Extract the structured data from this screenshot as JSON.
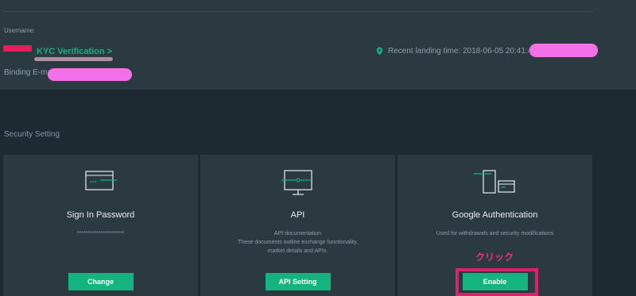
{
  "profile": {
    "username_label": "Username:",
    "kyc_link": "KYC Verification >",
    "binding_email_label": "Binding E-mai",
    "recent_landing_time": "Recent landing time: 2018-06-05 20:41:47"
  },
  "security": {
    "section_title": "Security Setting",
    "cards": [
      {
        "title": "Sign In Password",
        "subtitle": "**********************",
        "button": "Change",
        "icon": "password-card-icon"
      },
      {
        "title": "API",
        "subtitle_lines": [
          "API documentation",
          "These documents outline exchange functionality,",
          "market details and APIs."
        ],
        "button": "API Setting",
        "icon": "monitor-icon"
      },
      {
        "title": "Google Authentication",
        "subtitle": "Used for withdrawals and security modifications",
        "button": "Enable",
        "icon": "phone-device-icon"
      }
    ]
  },
  "annotation": {
    "click_label": "クリック"
  },
  "colors": {
    "accent": "#15b47f",
    "panel": "#2b3940",
    "background": "#1e2a31",
    "annotation": "#d8246b"
  }
}
